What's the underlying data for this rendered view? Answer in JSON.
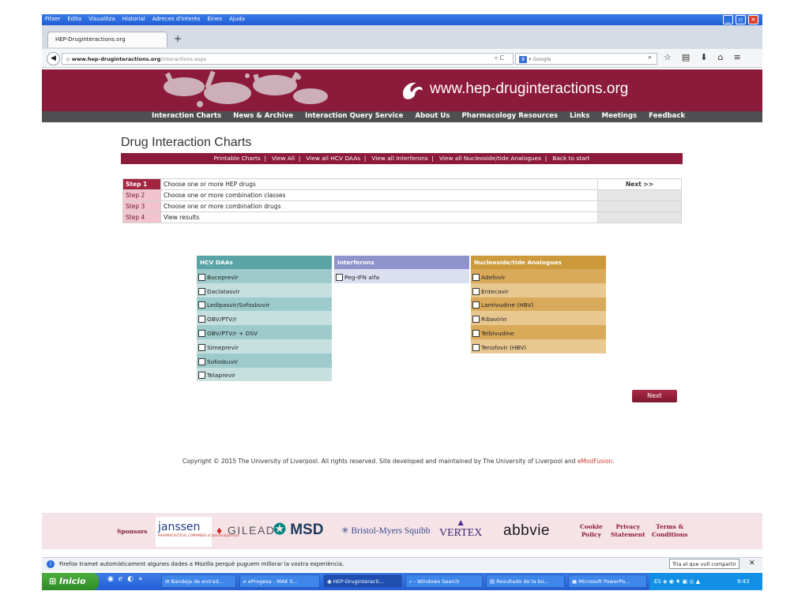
{
  "browser": {
    "menu": [
      "Fitxer",
      "Edita",
      "Visualitza",
      "Historial",
      "Adreces d'interès",
      "Eines",
      "Ajuda"
    ],
    "tab_title": "HEP-Druginteractions.org",
    "url_host": "www.hep-druginteractions.org",
    "url_path": "/interactions.aspx",
    "search_placeholder": "Google"
  },
  "site": {
    "url_text": "www.hep-druginteractions.org",
    "nav": [
      "Interaction Charts",
      "News & Archive",
      "Interaction Query Service",
      "About Us",
      "Pharmacology Resources",
      "Links",
      "Meetings",
      "Feedback"
    ]
  },
  "page": {
    "title": "Drug Interaction Charts",
    "subnav": [
      "Printable Charts",
      "View All",
      "View all HCV DAAs",
      "View all Interferons",
      "View all Nucleoside/tide Analogues",
      "Back to start"
    ],
    "steps": [
      {
        "label": "Step 1",
        "text": "Choose one or more HEP drugs"
      },
      {
        "label": "Step 2",
        "text": "Choose one or more combination classes"
      },
      {
        "label": "Step 3",
        "text": "Choose one or more combination drugs"
      },
      {
        "label": "Step 4",
        "text": "View results"
      }
    ],
    "next_top": "Next >>",
    "columns": {
      "hcv": {
        "title": "HCV DAAs",
        "items": [
          "Boceprevir",
          "Daclatasvir",
          "Ledipasvir/Sofosbuvir",
          "OBV/PTV/r",
          "OBV/PTV/r + DSV",
          "Simeprevir",
          "Sofosbuvir",
          "Telaprevir"
        ]
      },
      "ifn": {
        "title": "Interferons",
        "items": [
          "Peg-IFN alfa"
        ]
      },
      "nuc": {
        "title": "Nucleoside/tide Analogues",
        "items": [
          "Adefovir",
          "Entecavir",
          "Lamivudine (HBV)",
          "Ribavirin",
          "Telbivudine",
          "Tenofovir (HBV)"
        ]
      }
    },
    "next_button": "Next",
    "copyright": "Copyright © 2015 The University of Liverpool. All rights reserved. Site developed and maintained by The University of Liverpool and",
    "copyright_brand": "eModFusion."
  },
  "sponsors": {
    "label": "Sponsors",
    "janssen": "janssen",
    "janssen_sub": "PHARMACEUTICAL COMPANIES of Johnson&Johnson",
    "gilead": "GILEAD",
    "msd": "MSD",
    "bms": "Bristol-Myers Squibb",
    "vertex": "VERTEX",
    "abbvie": "abbvie",
    "cookie_1": "Cookie",
    "cookie_2": "Policy",
    "privacy_1": "Privacy",
    "privacy_2": "Statement",
    "terms_1": "Terms &",
    "terms_2": "Conditions"
  },
  "notification": {
    "text": "Firefox tramet automàticament algunes dades a Mozilla perquè puguem millorar la vostra experiència.",
    "button": "Tria el que vull compartir"
  },
  "taskbar": {
    "start": "Inicio",
    "tasks": [
      "Bandeja de entrad...",
      "eProgesa - MAK S...",
      "HEP-Druginteracti...",
      "- Windows Search",
      "Resultado de la bú...",
      "Microsoft PowerPo..."
    ],
    "lang": "ES",
    "time": "9:43"
  }
}
